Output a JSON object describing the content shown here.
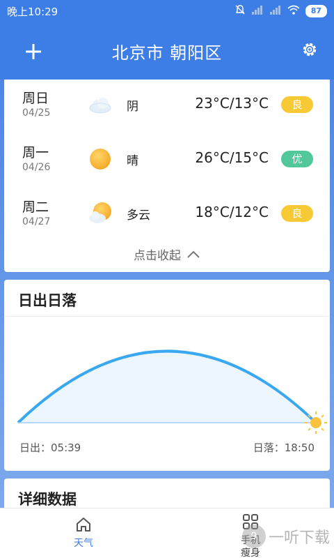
{
  "status_bar": {
    "time": "晚上10:29",
    "battery": "87"
  },
  "header": {
    "city": "北京市  朝阳区"
  },
  "forecast": [
    {
      "day": "周日",
      "date": "04/25",
      "weather": "阴",
      "icon": "cloudy-icon",
      "temp": "23°C/13°C",
      "aqi": "良",
      "aqi_color": "#f7c935"
    },
    {
      "day": "周一",
      "date": "04/26",
      "weather": "晴",
      "icon": "sunny-icon",
      "temp": "26°C/15°C",
      "aqi": "优",
      "aqi_color": "#52c79a"
    },
    {
      "day": "周二",
      "date": "04/27",
      "weather": "多云",
      "icon": "partly-cloudy-icon",
      "temp": "18°C/12°C",
      "aqi": "良",
      "aqi_color": "#f7c935"
    }
  ],
  "collapse_label": "点击收起",
  "sun": {
    "title": "日出日落",
    "sunrise": "日出：05:39",
    "sunset": "日落：18:50",
    "progress": 1.0
  },
  "detail": {
    "title": "详细数据"
  },
  "nav": {
    "weather": "天气",
    "slim_line1": "手机",
    "slim_line2": "瘦身"
  },
  "watermark": {
    "text": "一听下载",
    "badge": "9"
  },
  "colors": {
    "primary": "#3d7ee6",
    "arc": "#3aa8f0"
  }
}
